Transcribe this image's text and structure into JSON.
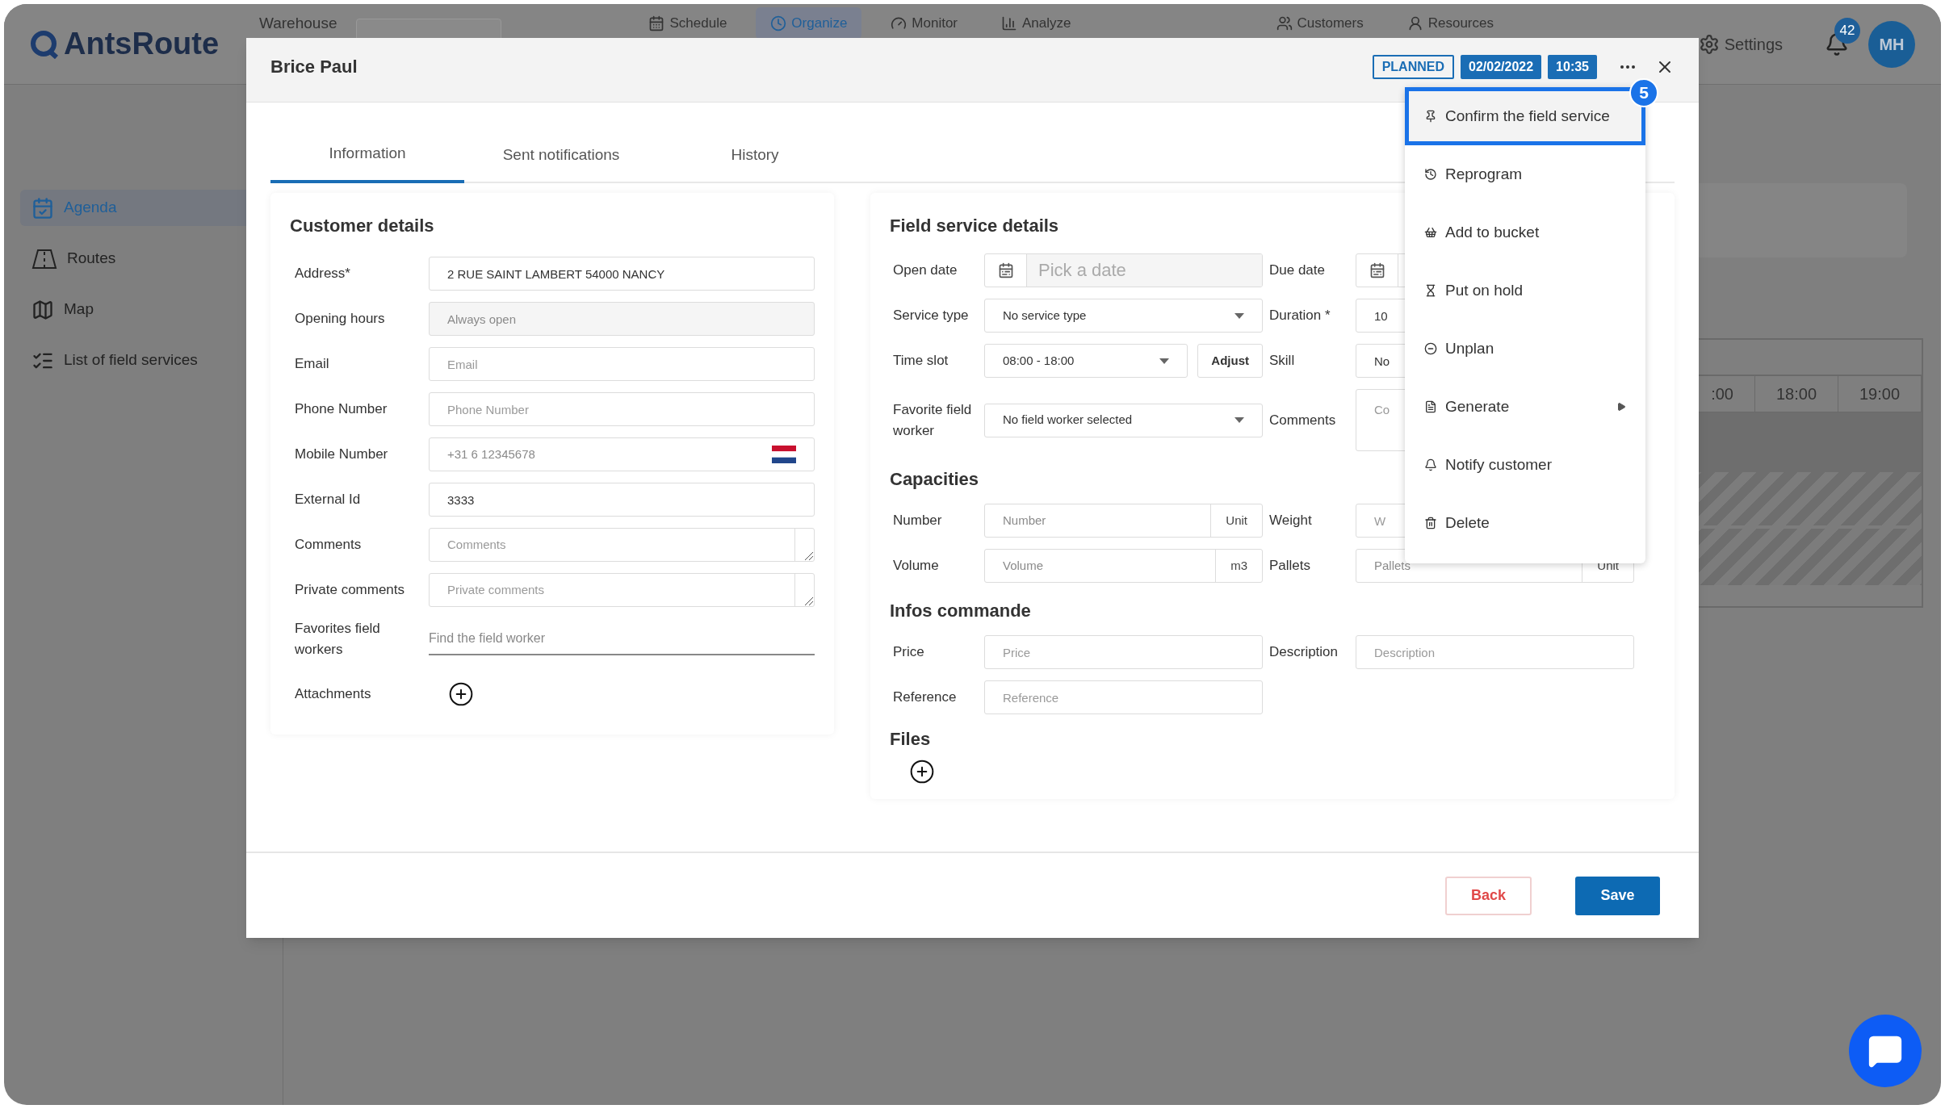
{
  "app": {
    "logo": "AntsRoute",
    "warehouse_label": "Warehouse",
    "nav": [
      {
        "label": "Schedule",
        "selected": false
      },
      {
        "label": "Organize",
        "selected": true
      },
      {
        "label": "Monitor",
        "selected": false
      },
      {
        "label": "Analyze",
        "selected": false
      },
      {
        "label": "Customers",
        "selected": false
      },
      {
        "label": "Resources",
        "selected": false
      },
      {
        "label": "Settings",
        "selected": false
      }
    ],
    "notifications": "42",
    "avatar": "MH",
    "sidebar": [
      {
        "label": "Agenda",
        "selected": true
      },
      {
        "label": "Routes",
        "selected": false
      },
      {
        "label": "Map",
        "selected": false
      },
      {
        "label": "List of field services",
        "selected": false
      }
    ],
    "calendar_hours": [
      ":00",
      "18:00",
      "19:00"
    ]
  },
  "modal": {
    "title": "Brice Paul",
    "status": "PLANNED",
    "date": "02/02/2022",
    "time": "10:35",
    "tabs": [
      {
        "label": "Information",
        "selected": true
      },
      {
        "label": "Sent notifications",
        "selected": false
      },
      {
        "label": "History",
        "selected": false
      }
    ],
    "customer_details": {
      "title": "Customer details",
      "fields": [
        {
          "label": "Address*",
          "kind": "text",
          "value": "2 RUE SAINT LAMBERT 54000 NANCY"
        },
        {
          "label": "Opening hours",
          "kind": "readonly",
          "placeholder": "Always open"
        },
        {
          "label": "Email",
          "kind": "text",
          "placeholder": "Email"
        },
        {
          "label": "Phone Number",
          "kind": "text",
          "placeholder": "Phone Number"
        },
        {
          "label": "Mobile Number",
          "kind": "phone",
          "placeholder": "+31 6 12345678"
        },
        {
          "label": "External Id",
          "kind": "text",
          "value": "3333"
        },
        {
          "label": "Comments",
          "kind": "textarea",
          "placeholder": "Comments"
        },
        {
          "label": "Private comments",
          "kind": "textarea",
          "placeholder": "Private comments"
        },
        {
          "label": "Favorites field workers",
          "kind": "search",
          "placeholder": "Find the field worker"
        },
        {
          "label": "Attachments",
          "kind": "add"
        }
      ]
    },
    "field_service_details": {
      "title": "Field service details",
      "rows": [
        [
          {
            "label": "Open date",
            "kind": "date",
            "placeholder": "Pick a date"
          },
          {
            "label": "Due date",
            "kind": "date"
          }
        ],
        [
          {
            "label": "Service type",
            "kind": "select",
            "value": "No service type"
          },
          {
            "label": "Duration *",
            "kind": "text",
            "value": "10"
          }
        ],
        [
          {
            "label": "Time slot",
            "kind": "select_button",
            "value": "08:00 - 18:00",
            "button": "Adjust"
          },
          {
            "label": "Skill",
            "kind": "text",
            "value": "No"
          }
        ],
        [
          {
            "label": "Favorite field worker",
            "kind": "select",
            "value": "No field worker selected"
          },
          {
            "label": "Comments",
            "kind": "tall_textarea",
            "placeholder": "Co"
          }
        ]
      ]
    },
    "capacities": {
      "title": "Capacities",
      "rows": [
        [
          {
            "label": "Number",
            "kind": "unit",
            "placeholder": "Number",
            "unit": "Unit"
          },
          {
            "label": "Weight",
            "kind": "text",
            "placeholder": "W"
          }
        ],
        [
          {
            "label": "Volume",
            "kind": "unit",
            "placeholder": "Volume",
            "unit": "m3"
          },
          {
            "label": "Pallets",
            "kind": "unit",
            "placeholder": "Pallets",
            "unit": "Unit"
          }
        ]
      ]
    },
    "infos_commande": {
      "title": "Infos commande",
      "rows": [
        [
          {
            "label": "Price",
            "kind": "text",
            "placeholder": "Price"
          },
          {
            "label": "Description",
            "kind": "text",
            "placeholder": "Description"
          }
        ],
        [
          {
            "label": "Reference",
            "kind": "text",
            "placeholder": "Reference"
          }
        ]
      ]
    },
    "files": {
      "title": "Files"
    },
    "menu": {
      "badge": "5",
      "items": [
        {
          "label": "Confirm the field service",
          "selected": true,
          "submenu": false
        },
        {
          "label": "Reprogram",
          "selected": false,
          "submenu": false
        },
        {
          "label": "Add to bucket",
          "selected": false,
          "submenu": false
        },
        {
          "label": "Put on hold",
          "selected": false,
          "submenu": false
        },
        {
          "label": "Unplan",
          "selected": false,
          "submenu": false
        },
        {
          "label": "Generate",
          "selected": false,
          "submenu": true
        },
        {
          "label": "Notify customer",
          "selected": false,
          "submenu": false
        },
        {
          "label": "Delete",
          "selected": false,
          "submenu": false
        }
      ]
    },
    "buttons": [
      {
        "label": "Back",
        "kind": "secondary"
      },
      {
        "label": "Save",
        "kind": "primary"
      }
    ]
  }
}
